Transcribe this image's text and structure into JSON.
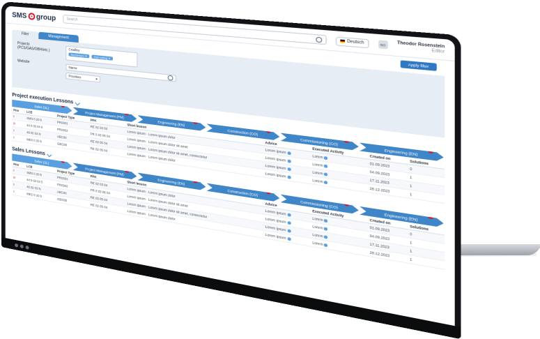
{
  "header": {
    "logo_text": "SMS",
    "logo_suffix": "group",
    "search_placeholder": "Search",
    "language": "Deutsch",
    "avatar_initials": "SG",
    "user_name": "Theodor Rosenstein",
    "user_role": "Editor"
  },
  "filters": {
    "tab_filter": "Filter",
    "tab_management": "Management",
    "projects_label": "Projects",
    "projects_sublabel": "(PCS/GAS/OBH/etc.)",
    "projects_value": "Cradley",
    "chips": [
      "Aluminium ✕",
      "Hot rolling ✕"
    ],
    "website_label": "Website",
    "website_value": "Name",
    "select_value": "Priorities",
    "apply_button": "Apply filter"
  },
  "project_execution": {
    "title": "Project execution Lessons",
    "stages": [
      {
        "label": "Sales (SL)",
        "badge": "1"
      },
      {
        "label": "Project Management (PM)",
        "badge": "2"
      },
      {
        "label": "Engineering (EN)",
        "badge": "3"
      },
      {
        "label": "Construction (CO)",
        "badge": "4"
      },
      {
        "label": "Commissioning (CO)",
        "badge": "5"
      },
      {
        "label": "Engineering (EN)",
        "badge": "6"
      }
    ],
    "columns": [
      "Prio",
      "LCE",
      "Project Type",
      "PFK",
      "Short lesson",
      "Advice",
      "Executed Activity",
      "Created on",
      "Solutions"
    ],
    "rows": [
      [
        "!",
        "SMS 0 20 b",
        "PR0301",
        "RE 02 03 04",
        "Lorem ipsum",
        "Lorem ipsum dolor",
        "Lorem ipsum",
        "Lorem",
        "01.09.2023",
        "0"
      ],
      [
        "!!",
        "44 0 03 04 5",
        "PR0302",
        "PR 0 03 05 04",
        "Lorem ipsum",
        "Lorem ipsum dolor sit amet",
        "Lorem ipsum",
        "Lorem",
        "04.09.2023",
        "1"
      ],
      [
        "!",
        "46 02 03 N",
        "ABC00",
        "RE 03 05 04",
        "Lorem ipsum",
        "Lorem ipsum dolor sit amet, consectetur",
        "Lorem ipsum",
        "Lorem",
        "17.11.2023",
        "1"
      ],
      [
        "!",
        "MES 0 20 b",
        "GBG00",
        "RE 02 05 04",
        "Lorem ipsum",
        "Lorem ipsum dolor",
        "Lorem ipsum",
        "Lorem",
        "28.12.2023",
        "1"
      ]
    ]
  },
  "sales_lessons": {
    "title": "Sales Lessons",
    "stages": [
      {
        "label": "Sales (SL)",
        "badge": "1"
      },
      {
        "label": "Project Management (PM)",
        "badge": "2"
      },
      {
        "label": "Engineering (EN)",
        "badge": "3"
      },
      {
        "label": "Construction (CO)",
        "badge": "4"
      },
      {
        "label": "Commissioning (CO)",
        "badge": "5"
      },
      {
        "label": "Engineering (EN)",
        "badge": "6"
      }
    ],
    "columns": [
      "Prio",
      "LCE",
      "Project Type",
      "PFK",
      "Short lesson",
      "Advice",
      "Executed Activity",
      "Created on",
      "Solutions"
    ],
    "rows": [
      [
        "!",
        "SMS 0 20 b",
        "PR0301",
        "RE 02 03 04",
        "Lorem ipsum",
        "Lorem ipsum dolor",
        "Lorem ipsum",
        "Lorem",
        "01.09.2023",
        "0"
      ],
      [
        "!!",
        "44 0 03 04 5",
        "PR0302",
        "PR 0 03 05 04",
        "Lorem ipsum",
        "Lorem ipsum dolor sit amet",
        "Lorem ipsum",
        "Lorem",
        "04.09.2023",
        "1"
      ],
      [
        "!",
        "46 02 03 N",
        "ABC00",
        "RE 03 05 04",
        "Lorem ipsum",
        "Lorem ipsum dolor sit amet, consectetur",
        "Lorem ipsum",
        "Lorem",
        "17.11.2023",
        "1"
      ],
      [
        "!",
        "MES 0 20 b",
        "GBG00",
        "RE 02 05 04",
        "Lorem ipsum",
        "Lorem ipsum dolor",
        "Lorem ipsum",
        "Lorem",
        "28.12.2023",
        "1"
      ]
    ]
  }
}
